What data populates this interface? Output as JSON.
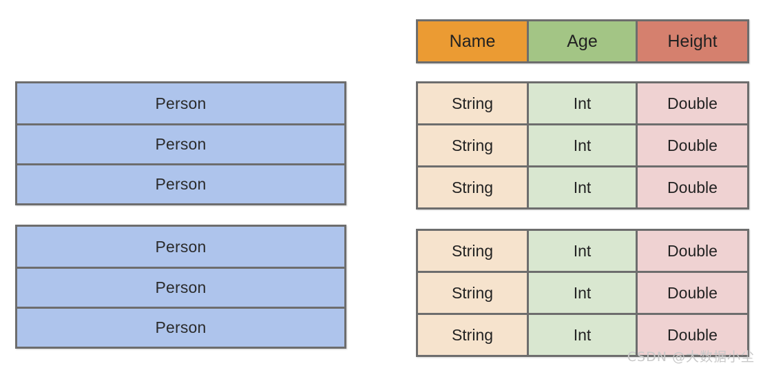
{
  "diagram": {
    "objects": {
      "label": "Person",
      "blocks": [
        {
          "rows": [
            "Person",
            "Person",
            "Person"
          ]
        },
        {
          "rows": [
            "Person",
            "Person",
            "Person"
          ]
        }
      ]
    },
    "schema": {
      "header": {
        "cells": [
          {
            "label": "Name",
            "color": "#eb9b33"
          },
          {
            "label": "Age",
            "color": "#a3c585"
          },
          {
            "label": "Height",
            "color": "#d5806e"
          }
        ]
      },
      "body_blocks": [
        {
          "rows": [
            {
              "cells": [
                "String",
                "Int",
                "Double"
              ]
            },
            {
              "cells": [
                "String",
                "Int",
                "Double"
              ]
            },
            {
              "cells": [
                "String",
                "Int",
                "Double"
              ]
            }
          ]
        },
        {
          "rows": [
            {
              "cells": [
                "String",
                "Int",
                "Double"
              ]
            },
            {
              "cells": [
                "String",
                "Int",
                "Double"
              ]
            },
            {
              "cells": [
                "String",
                "Int",
                "Double"
              ]
            }
          ]
        }
      ],
      "column_colors": [
        "#f6e3cd",
        "#d9e7d0",
        "#efd2d2"
      ]
    },
    "colors": {
      "object_fill": "#aec4ec",
      "border": "#6d6d6d",
      "background": "#ffffff",
      "text": "#2b2b2b",
      "watermark": "#c9c9c9"
    }
  },
  "watermark": {
    "text": "CSDN @大数据小尘"
  }
}
